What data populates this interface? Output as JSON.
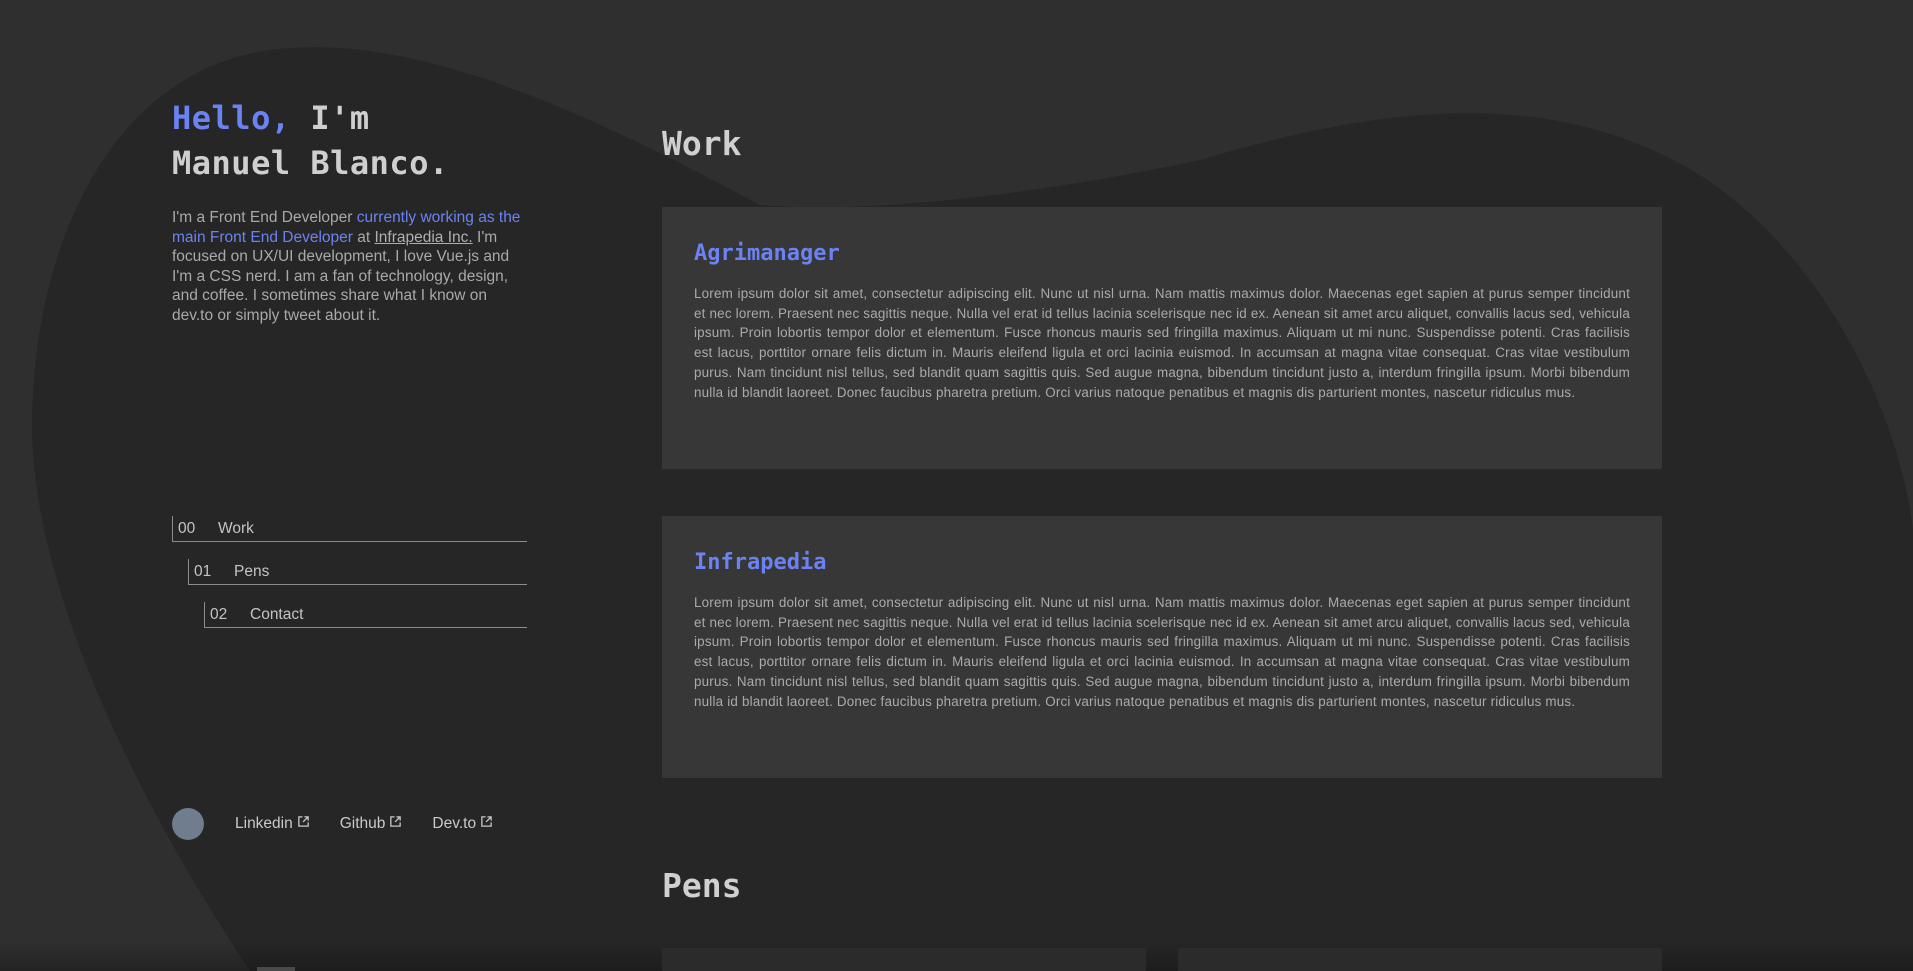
{
  "colors": {
    "accent": "#6b83f2",
    "background": "#2f2f2f",
    "blob": "#262626",
    "card": "#373737",
    "avatar": "#6f7d8f"
  },
  "hero": {
    "greeting": "Hello,",
    "intro": " I'm",
    "name": "Manuel Blanco."
  },
  "bio": {
    "part1": "I'm a Front End Developer ",
    "accent": "currently working as the main Front End Developer",
    "part2": " at ",
    "company_link": "Infrapedia Inc.",
    "part3": " I'm focused on UX/UI development, I love Vue.js and I'm a CSS nerd. I am a fan of technology, design, and coffee. I sometimes share what I know on dev.to or simply tweet about it."
  },
  "nav": {
    "items": [
      {
        "num": "00",
        "label": "Work"
      },
      {
        "num": "01",
        "label": "Pens"
      },
      {
        "num": "02",
        "label": "Contact"
      }
    ]
  },
  "social": {
    "links": [
      {
        "label": "Linkedin",
        "icon": "external-link-icon"
      },
      {
        "label": "Github",
        "icon": "external-link-icon"
      },
      {
        "label": "Dev.to",
        "icon": "external-link-icon"
      }
    ]
  },
  "work": {
    "title": "Work",
    "cards": [
      {
        "title": "Agrimanager",
        "text": "Lorem ipsum dolor sit amet, consectetur adipiscing elit. Nunc ut nisl urna. Nam mattis maximus dolor. Maecenas eget sapien at purus semper tincidunt et nec lorem. Praesent nec sagittis neque. Nulla vel erat id tellus lacinia scelerisque nec id ex. Aenean sit amet arcu aliquet, convallis lacus sed, vehicula ipsum. Proin lobortis tempor dolor et elementum. Fusce rhoncus mauris sed fringilla maximus. Aliquam ut mi nunc. Suspendisse potenti. Cras facilisis est lacus, porttitor ornare felis dictum in. Mauris eleifend ligula et orci lacinia euismod. In accumsan at magna vitae consequat. Cras vitae vestibulum purus. Nam tincidunt nisl tellus, sed blandit quam sagittis quis. Sed augue magna, bibendum tincidunt justo a, interdum fringilla ipsum. Morbi bibendum nulla id blandit laoreet. Donec faucibus pharetra pretium. Orci varius natoque penatibus et magnis dis parturient montes, nascetur ridiculus mus."
      },
      {
        "title": "Infrapedia",
        "text": "Lorem ipsum dolor sit amet, consectetur adipiscing elit. Nunc ut nisl urna. Nam mattis maximus dolor. Maecenas eget sapien at purus semper tincidunt et nec lorem. Praesent nec sagittis neque. Nulla vel erat id tellus lacinia scelerisque nec id ex. Aenean sit amet arcu aliquet, convallis lacus sed, vehicula ipsum. Proin lobortis tempor dolor et elementum. Fusce rhoncus mauris sed fringilla maximus. Aliquam ut mi nunc. Suspendisse potenti. Cras facilisis est lacus, porttitor ornare felis dictum in. Mauris eleifend ligula et orci lacinia euismod. In accumsan at magna vitae consequat. Cras vitae vestibulum purus. Nam tincidunt nisl tellus, sed blandit quam sagittis quis. Sed augue magna, bibendum tincidunt justo a, interdum fringilla ipsum. Morbi bibendum nulla id blandit laoreet. Donec faucibus pharetra pretium. Orci varius natoque penatibus et magnis dis parturient montes, nascetur ridiculus mus."
      }
    ]
  },
  "pens": {
    "title": "Pens"
  }
}
